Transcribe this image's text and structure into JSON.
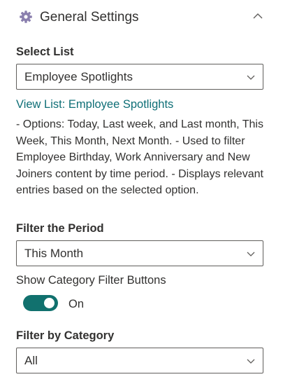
{
  "header": {
    "title": "General Settings",
    "icon": "gear-icon",
    "collapse_icon": "chevron-up-icon"
  },
  "select_list": {
    "label": "Select List",
    "value": "Employee Spotlights"
  },
  "view_list_link": "View List: Employee Spotlights",
  "description": "- Options: Today, Last week, and Last month, This Week, This Month, Next Month. - Used to filter Employee Birthday, Work Anniversary and New Joiners content by time period. - Displays relevant entries based on the selected option.",
  "filter_period": {
    "label": "Filter the Period",
    "value": "This Month"
  },
  "category_buttons": {
    "label": "Show Category Filter Buttons",
    "state_text": "On",
    "on": true
  },
  "filter_category": {
    "label": "Filter by Category",
    "value": "All"
  },
  "colors": {
    "accent": "#11716e",
    "link": "#0f6f77",
    "text": "#323130",
    "border": "#605e5c"
  }
}
